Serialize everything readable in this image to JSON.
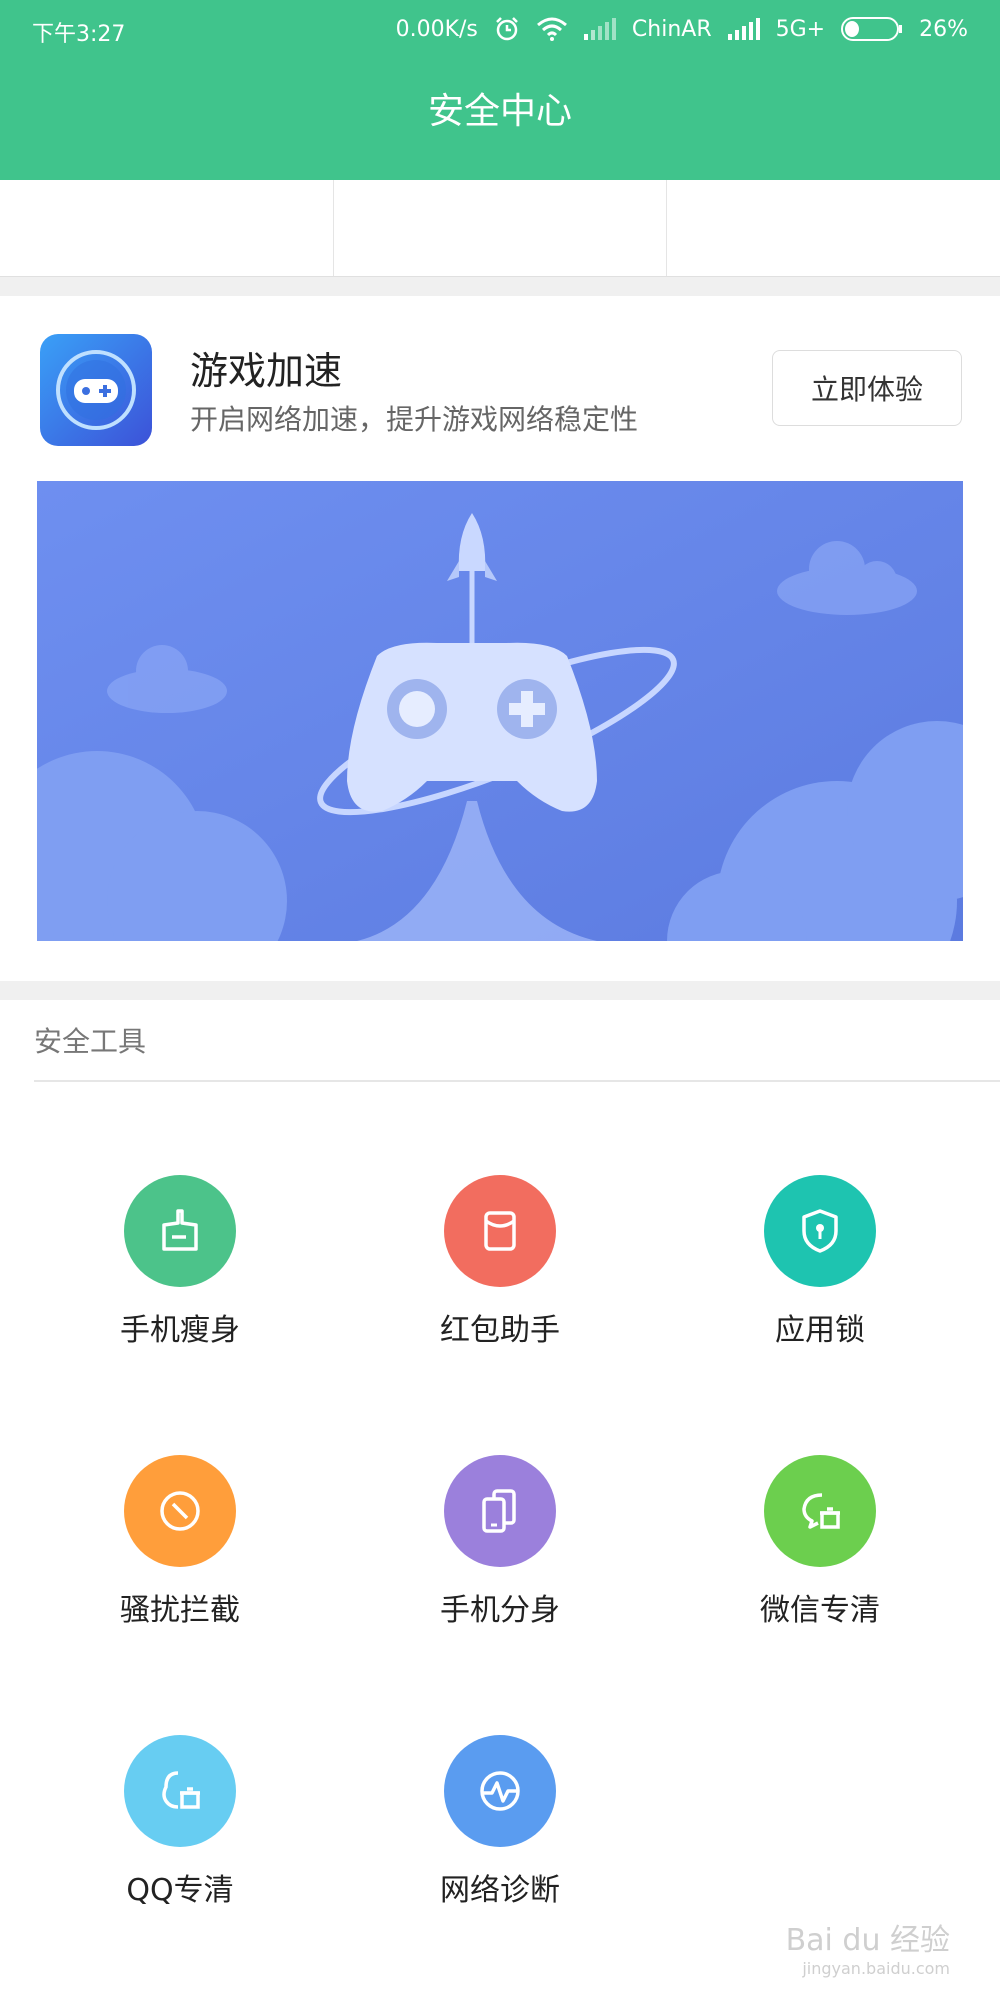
{
  "status_bar": {
    "time": "下午3:27",
    "speed": "0.00K/s",
    "carrier": "ChinAR",
    "network": "5G+",
    "battery": "26%"
  },
  "header": {
    "title": "安全中心"
  },
  "game_card": {
    "title": "游戏加速",
    "description": "开启网络加速，提升游戏网络稳定性",
    "button": "立即体验"
  },
  "tools": {
    "title": "安全工具",
    "items": [
      {
        "label": "手机瘦身",
        "icon": "cleanup-icon",
        "color": "#4cc38a"
      },
      {
        "label": "红包助手",
        "icon": "red-packet-icon",
        "color": "#f26d5f"
      },
      {
        "label": "应用锁",
        "icon": "shield-lock-icon",
        "color": "#1ec4b0"
      },
      {
        "label": "骚扰拦截",
        "icon": "block-icon",
        "color": "#ff9e3b"
      },
      {
        "label": "手机分身",
        "icon": "dual-phone-icon",
        "color": "#9b80dc"
      },
      {
        "label": "微信专清",
        "icon": "wechat-clean-icon",
        "color": "#6ccf4e"
      },
      {
        "label": "QQ专清",
        "icon": "qq-clean-icon",
        "color": "#67cdf2"
      },
      {
        "label": "网络诊断",
        "icon": "network-diagnosis-icon",
        "color": "#5a9cf0"
      }
    ]
  },
  "watermark": {
    "main": "Bai du 经验",
    "sub": "jingyan.baidu.com"
  }
}
